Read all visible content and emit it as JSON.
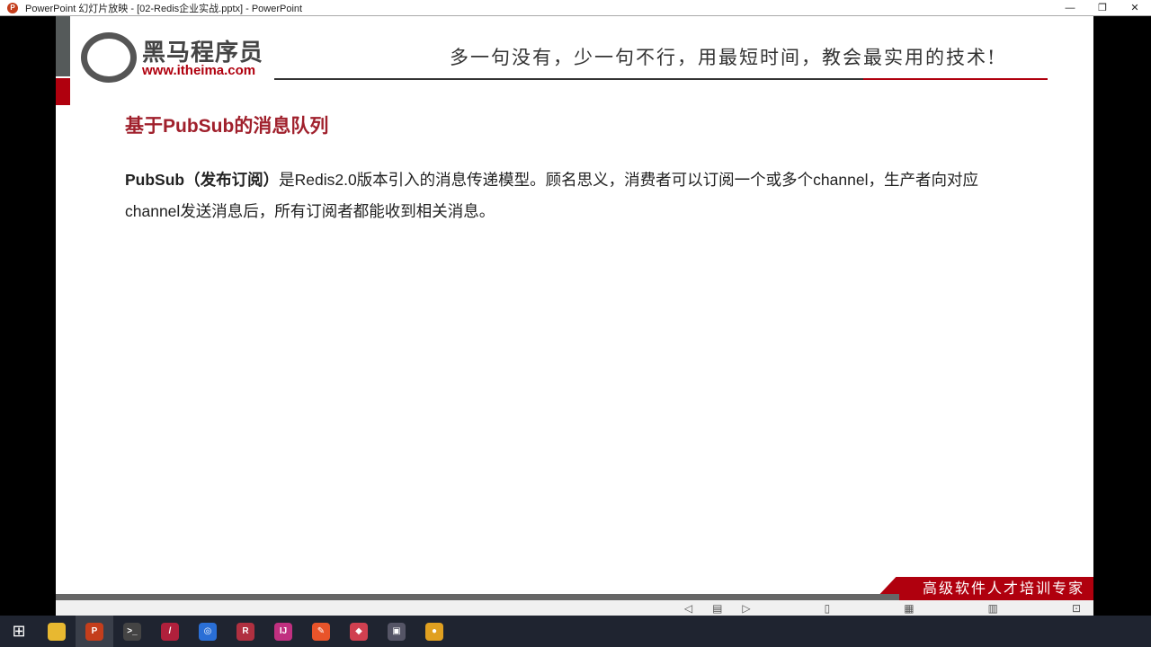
{
  "window": {
    "title": "PowerPoint 幻灯片放映 - [02-Redis企业实战.pptx] - PowerPoint",
    "controls": {
      "minimize": "—",
      "restore": "❐",
      "close": "✕"
    }
  },
  "slide": {
    "logo_cn": "黑马程序员",
    "logo_url": "www.itheima.com",
    "slogan": "多一句没有，少一句不行，用最短时间，教会最实用的技术!",
    "heading": "基于PubSub的消息队列",
    "body_bold": "PubSub（发布订阅）",
    "body_text": "是Redis2.0版本引入的消息传递模型。顾名思义，消费者可以订阅一个或多个channel，生产者向对应channel发送消息后，所有订阅者都能收到相关消息。",
    "banner": "高级软件人才培训专家"
  },
  "slideshow_controls": {
    "prev": "◁",
    "slides": "▤",
    "next": "▷",
    "notes": "▯",
    "grid": "▦",
    "reading": "▥",
    "present": "⊡"
  },
  "taskbar": {
    "start": "⊞",
    "apps": [
      {
        "name": "file-explorer",
        "label": "",
        "color": "#e8b830"
      },
      {
        "name": "powerpoint",
        "label": "P",
        "color": "#c43e1c"
      },
      {
        "name": "terminal",
        "label": ">_",
        "color": "#444"
      },
      {
        "name": "pen-app",
        "label": "/",
        "color": "#b0203c"
      },
      {
        "name": "browser-app",
        "label": "◎",
        "color": "#2a6fd6"
      },
      {
        "name": "redis-app",
        "label": "R",
        "color": "#b03040"
      },
      {
        "name": "intellij",
        "label": "IJ",
        "color": "#c03080"
      },
      {
        "name": "postman",
        "label": "✎",
        "color": "#e8542a"
      },
      {
        "name": "drawing-app",
        "label": "◆",
        "color": "#d04050"
      },
      {
        "name": "remote-app",
        "label": "▣",
        "color": "#556"
      },
      {
        "name": "chrome",
        "label": "●",
        "color": "#e0a020"
      }
    ]
  }
}
